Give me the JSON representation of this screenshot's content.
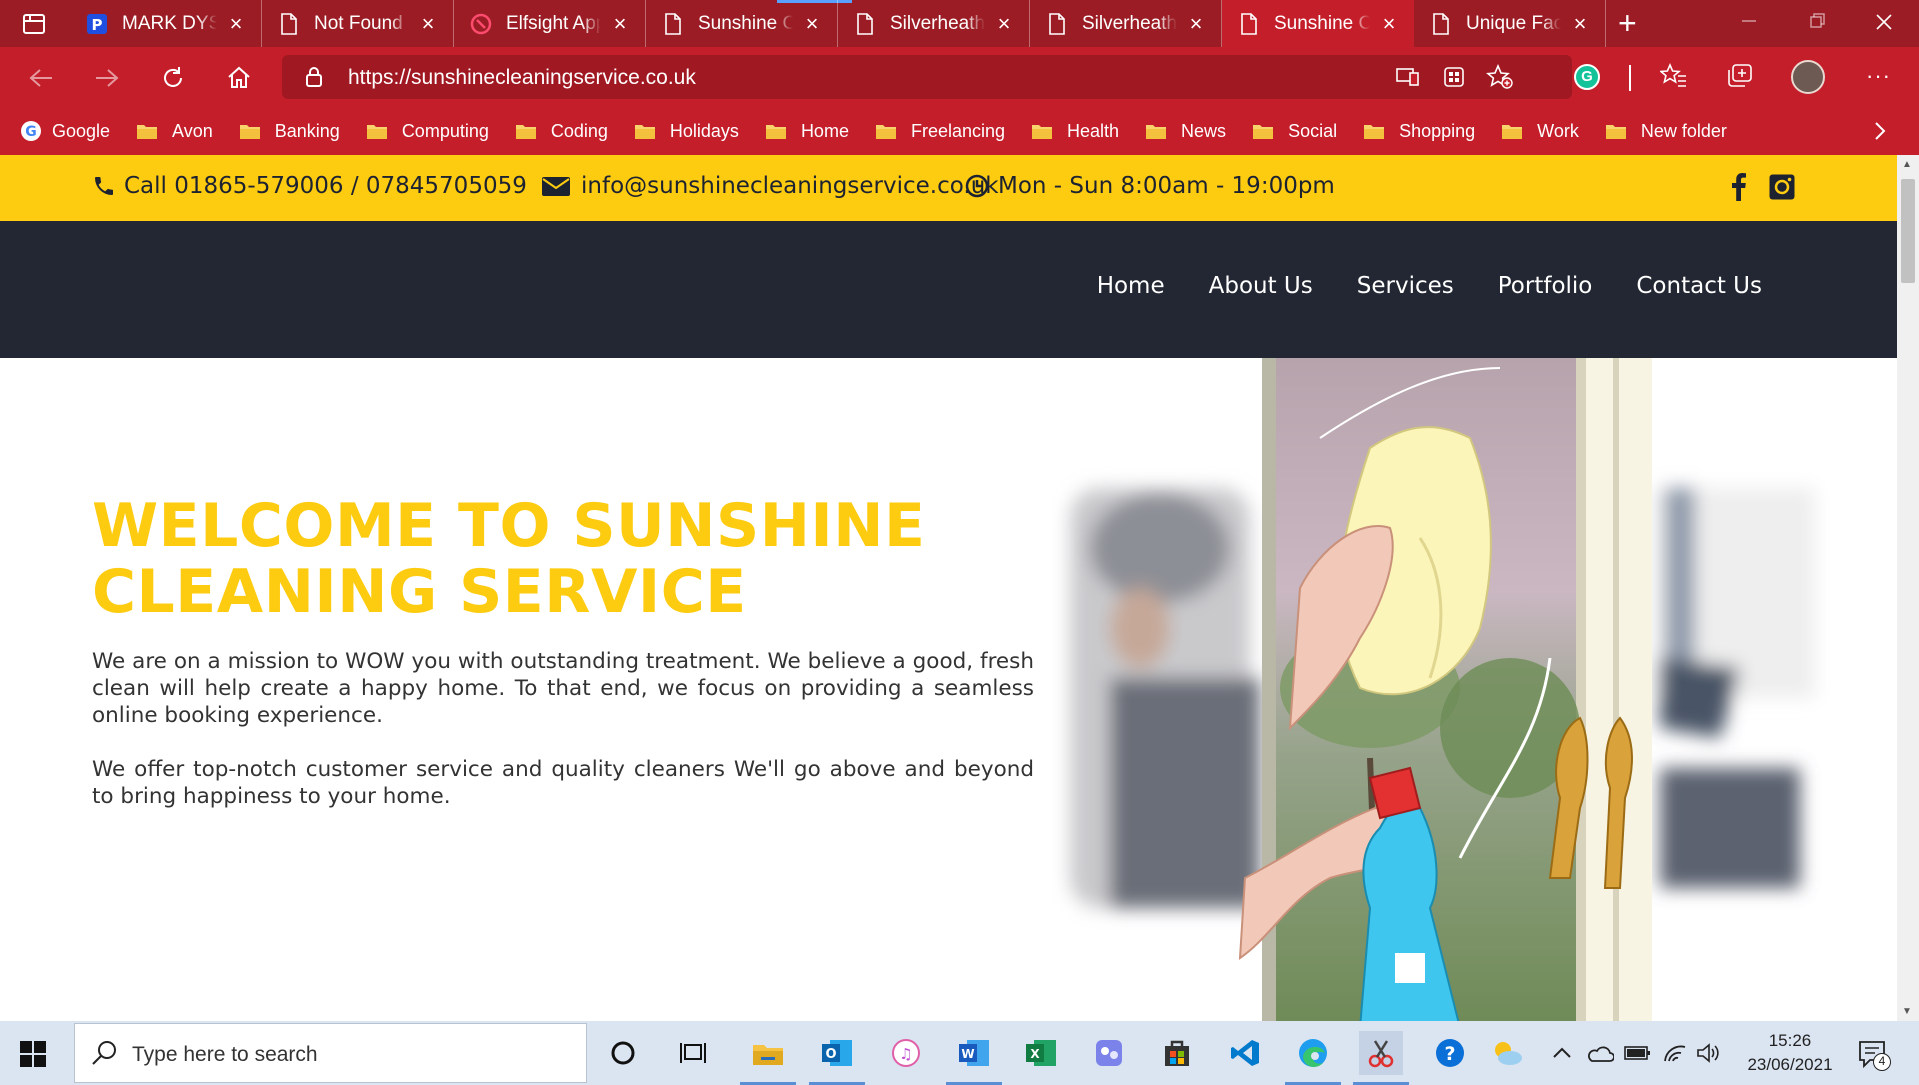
{
  "browser": {
    "tabs": [
      {
        "title": "MARK DYSON",
        "icon": "p-brand-icon"
      },
      {
        "title": "Not Found",
        "icon": "page-icon"
      },
      {
        "title": "Elfsight Apps",
        "icon": "elfsight-icon"
      },
      {
        "title": "Sunshine Cleaning",
        "icon": "page-icon"
      },
      {
        "title": "Silverheath",
        "icon": "page-icon"
      },
      {
        "title": "Silverheath",
        "icon": "page-icon"
      },
      {
        "title": "Sunshine Cleaning",
        "icon": "page-icon",
        "active": true
      },
      {
        "title": "Unique Facilities",
        "icon": "page-icon"
      }
    ],
    "url": "https://sunshinecleaningservice.co.uk",
    "bookmarks": [
      "Google",
      "Avon",
      "Banking",
      "Computing",
      "Coding",
      "Holidays",
      "Home",
      "Freelancing",
      "Health",
      "News",
      "Social",
      "Shopping",
      "Work",
      "New folder"
    ],
    "colors": {
      "frame": "#9b1c24",
      "toolbar": "#c41e2a"
    }
  },
  "site": {
    "topbar": {
      "phone": "Call 01865-579006 / 07845705059",
      "email": "info@sunshinecleaningservice.co.uk",
      "hours": "Mon - Sun 8:00am - 19:00pm"
    },
    "menu": [
      "Home",
      "About Us",
      "Services",
      "Portfolio",
      "Contact Us"
    ],
    "hero": {
      "title_line1": "WELCOME TO SUNSHINE",
      "title_line2": "CLEANING SERVICE",
      "paragraph1": "We are on a mission to WOW you with outstanding treatment. We believe a good, fresh clean will help create a happy home. To that end, we focus on providing a seamless online booking experience.",
      "paragraph2": "We offer top-notch customer service and quality cleaners We'll go above and beyond to bring happiness to your home."
    },
    "colors": {
      "yellow": "#fdcb10",
      "navy": "#222733"
    }
  },
  "taskbar": {
    "search_placeholder": "Type here to search",
    "time": "15:26",
    "date": "23/06/2021",
    "notification_count": "4"
  }
}
